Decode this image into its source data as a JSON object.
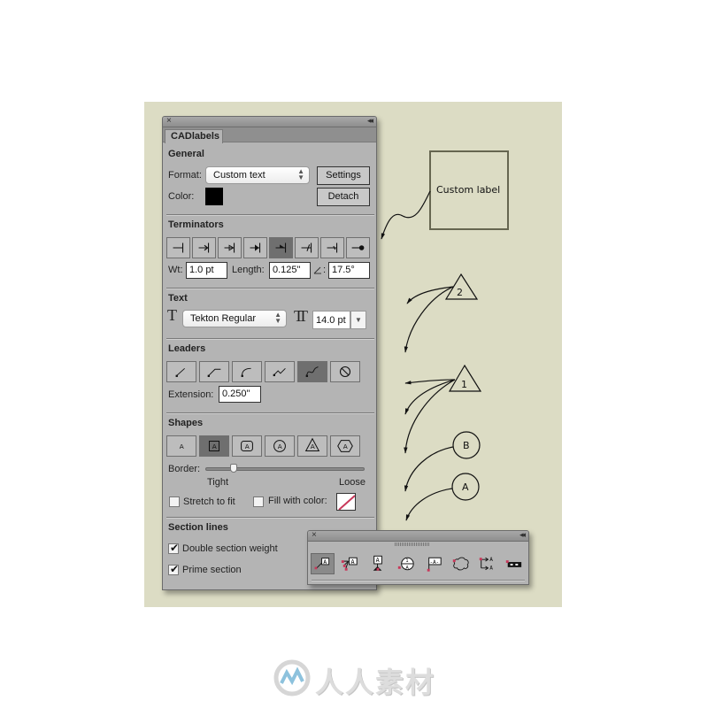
{
  "panel": {
    "close_icon": "×",
    "collapse_icon": "◂◂",
    "tab_label": "CADlabels",
    "general": {
      "title": "General",
      "format_label": "Format:",
      "format_value": "Custom text",
      "settings_button": "Settings",
      "color_label": "Color:",
      "color_value": "#000000",
      "detach_button": "Detach"
    },
    "terminators": {
      "title": "Terminators",
      "buttons": [
        {
          "name": "terminator-bar",
          "selected": false
        },
        {
          "name": "terminator-open-arrow-bar",
          "selected": false
        },
        {
          "name": "terminator-triangle-bar",
          "selected": false
        },
        {
          "name": "terminator-filled-arrow-bar",
          "selected": false
        },
        {
          "name": "terminator-half-arrow-bar",
          "selected": true
        },
        {
          "name": "terminator-slash-bar",
          "selected": false
        },
        {
          "name": "terminator-tick-bar",
          "selected": false
        },
        {
          "name": "terminator-dot",
          "selected": false
        }
      ],
      "wt_label": "Wt:",
      "wt_value": "1.0 pt",
      "length_label": "Length:",
      "length_value": "0.125\"",
      "angle_label": ":",
      "angle_value": "17.5°"
    },
    "text": {
      "title": "Text",
      "font_value": "Tekton Regular",
      "size_value": "14.0 pt"
    },
    "leaders": {
      "title": "Leaders",
      "buttons": [
        {
          "name": "leader-straight",
          "selected": false
        },
        {
          "name": "leader-elbow",
          "selected": false
        },
        {
          "name": "leader-curve",
          "selected": false
        },
        {
          "name": "leader-zigzag",
          "selected": false
        },
        {
          "name": "leader-wave",
          "selected": true
        },
        {
          "name": "leader-none",
          "selected": false
        }
      ],
      "extension_label": "Extension:",
      "extension_value": "0.250\""
    },
    "shapes": {
      "title": "Shapes",
      "buttons": [
        {
          "name": "shape-none",
          "glyph": "A",
          "selected": false
        },
        {
          "name": "shape-square",
          "glyph": "A",
          "selected": true
        },
        {
          "name": "shape-rounded-square",
          "glyph": "A",
          "selected": false
        },
        {
          "name": "shape-circle",
          "glyph": "A",
          "selected": false
        },
        {
          "name": "shape-triangle",
          "glyph": "A",
          "selected": false
        },
        {
          "name": "shape-hexagon",
          "glyph": "A",
          "selected": false
        }
      ],
      "border_label": "Border:",
      "border_value": 0.18,
      "tight_label": "Tight",
      "loose_label": "Loose",
      "stretch_label": "Stretch to fit",
      "stretch_checked": false,
      "fill_label": "Fill with color:",
      "fill_checked": false,
      "fill_color": "none"
    },
    "section_lines": {
      "title": "Section lines",
      "double_label": "Double section weight",
      "double_checked": true,
      "prime_label": "Prime section",
      "prime_checked": true
    }
  },
  "toolbar": {
    "close_icon": "×",
    "collapse_icon": "◂◂",
    "tools": [
      {
        "name": "label-tool",
        "selected": true
      },
      {
        "name": "multi-leader-tool",
        "selected": false
      },
      {
        "name": "datum-target-tool",
        "selected": false
      },
      {
        "name": "section-circle-tool",
        "selected": false
      },
      {
        "name": "flag-label-tool",
        "selected": false
      },
      {
        "name": "revision-cloud-tool",
        "selected": false
      },
      {
        "name": "section-arrow-tool",
        "selected": false
      },
      {
        "name": "scale-bar-tool",
        "selected": false
      }
    ]
  },
  "drawing": {
    "custom_label": "Custom label",
    "triangle_labels": [
      "2",
      "1"
    ],
    "circle_labels": [
      "B",
      "A"
    ]
  },
  "watermark": {
    "text": "人人素材"
  },
  "colors": {
    "canvas_bg": "#dcdcc4",
    "panel_bg": "#b4b4b4",
    "selected_btn": "#6f6f6f",
    "accent_red": "#c8385a"
  }
}
